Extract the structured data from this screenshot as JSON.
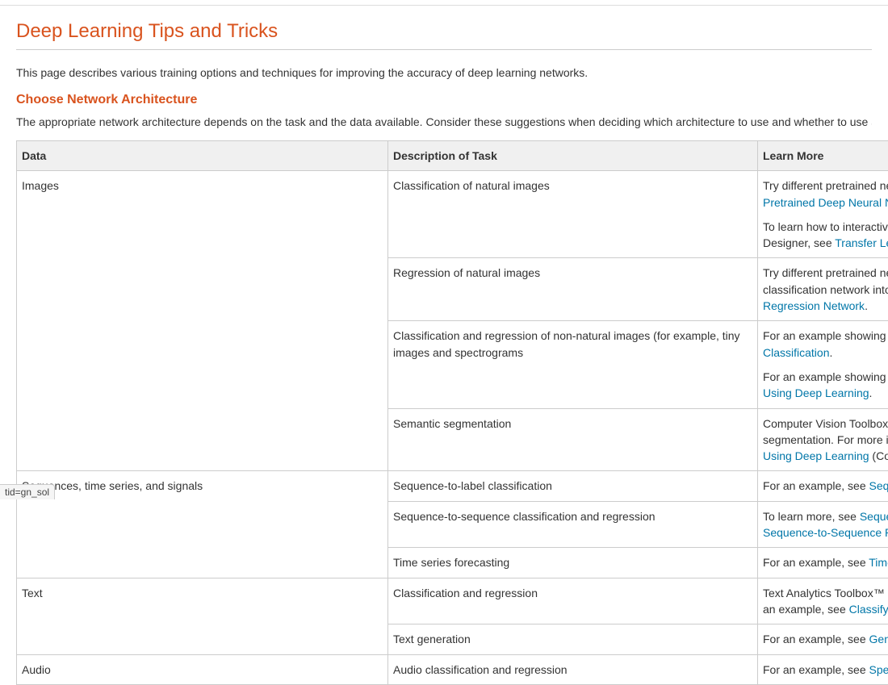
{
  "page": {
    "title": "Deep Learning Tips and Tricks",
    "intro": "This page describes various training options and techniques for improving the accuracy of deep learning networks."
  },
  "section": {
    "heading": "Choose Network Architecture",
    "desc": "The appropriate network architecture depends on the task and the data available. Consider these suggestions when deciding which architecture to use and whether to use a pretrained network or to train fr"
  },
  "table": {
    "headers": {
      "data": "Data",
      "desc": "Description of Task",
      "learn": "Learn More"
    },
    "rows": {
      "images": {
        "data": "Images",
        "r1_desc": "Classification of natural images",
        "r1_l1_pre": "Try different pretrained networks",
        "r1_l1_link": "Pretrained Deep Neural Network",
        "r1_l2_pre": "To learn how to interactively prep",
        "r1_l2_mid": "Designer, see ",
        "r1_l2_link": "Transfer Learning",
        "r2_desc": "Regression of natural images",
        "r2_l1_a": "Try different pretrained networks",
        "r2_l1_b": "classification network into a reg",
        "r2_l1_link": "Regression Network",
        "r2_l1_dot": ".",
        "r3_desc": "Classification and regression of non-natural images (for example, tiny images and spectrograms",
        "r3_l1_pre": "For an example showing how to ",
        "r3_l1_link": "Classification",
        "r3_l1_dot": ".",
        "r3_l2_pre": "For an example showing how to ",
        "r3_l2_link": "Using Deep Learning",
        "r3_l2_dot": ".",
        "r4_desc": "Semantic segmentation",
        "r4_l1_a": "Computer Vision Toolbox™ provi",
        "r4_l1_b": "segmentation. For more informa",
        "r4_l1_link": "Using Deep Learning",
        "r4_l1_post": " (Computer"
      },
      "seq": {
        "data": "Sequences, time series, and signals",
        "r1_desc": "Sequence-to-label classification",
        "r1_pre": "For an example, see ",
        "r1_link": "Sequence C",
        "r2_desc": "Sequence-to-sequence classification and regression",
        "r2_pre": "To learn more, see ",
        "r2_link1": "Sequence-to-",
        "r2_link2": "Sequence-to-Sequence Regressi",
        "r3_desc": "Time series forecasting",
        "r3_pre": "For an example, see ",
        "r3_link": "Time Series"
      },
      "text": {
        "data": "Text",
        "r1_desc": "Classification and regression",
        "r1_l1_a": "Text Analytics Toolbox™ provide",
        "r1_l1_b": "an example, see ",
        "r1_l1_link": "Classify Text Da",
        "r2_desc": "Text generation",
        "r2_pre": "For an example, see ",
        "r2_link": "Generate Te"
      },
      "audio": {
        "data": "Audio",
        "r1_desc": "Audio classification and regression",
        "r1_pre": "For an example, see ",
        "r1_link": "Speech Cor"
      }
    }
  },
  "badge": "tid=gn_sol"
}
